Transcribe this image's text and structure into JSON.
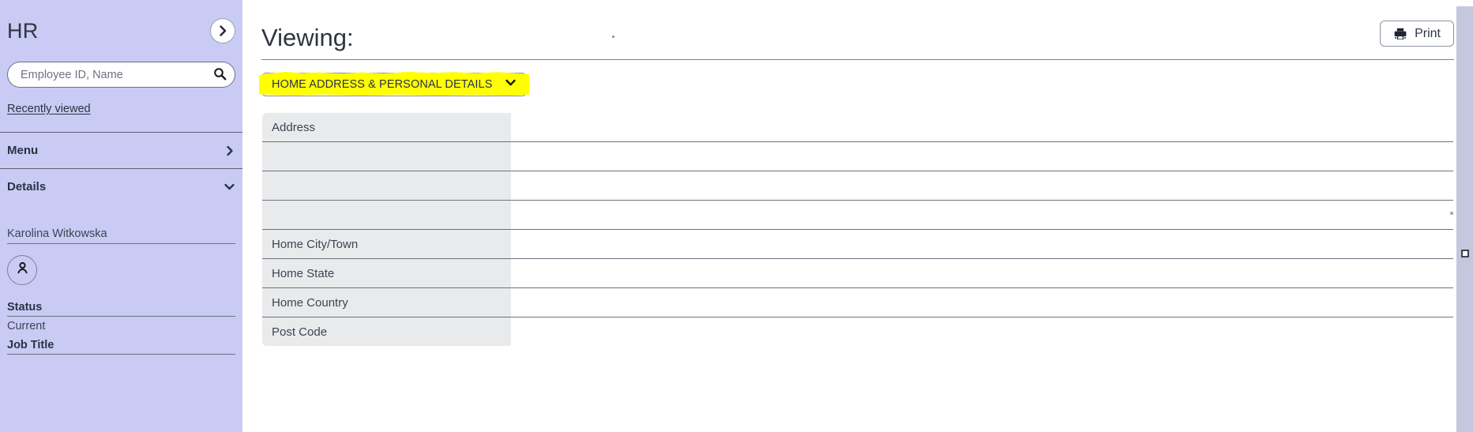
{
  "sidebar": {
    "title": "HR",
    "expand_icon": "chevron-right-circle-icon",
    "search": {
      "placeholder": "Employee ID, Name",
      "value": "",
      "icon": "search-icon"
    },
    "recently_viewed_label": "Recently viewed",
    "nav": [
      {
        "label": "Menu",
        "icon": "chevron-right-icon",
        "state": "collapsed"
      },
      {
        "label": "Details",
        "icon": "chevron-down-icon",
        "state": "expanded"
      }
    ],
    "employee_name": "Karolina Witkowska",
    "avatar_icon": "person-icon",
    "fields": [
      {
        "label": "Status",
        "value": "Current"
      },
      {
        "label": "Job Title",
        "value": ""
      }
    ]
  },
  "main": {
    "page_title": "Viewing:",
    "print_button": {
      "label": "Print",
      "icon": "printer-icon"
    },
    "section_dropdown": {
      "label": "HOME ADDRESS & PERSONAL DETAILS",
      "caret_icon": "chevron-down-icon",
      "highlight_color": "#ffff00"
    },
    "table": {
      "rows": [
        {
          "label": "Address",
          "value": ""
        },
        {
          "label": "",
          "value": ""
        },
        {
          "label": "",
          "value": ""
        },
        {
          "label": "",
          "value": ""
        },
        {
          "label": "Home City/Town",
          "value": ""
        },
        {
          "label": "Home State",
          "value": ""
        },
        {
          "label": "Home Country",
          "value": ""
        },
        {
          "label": "Post Code",
          "value": ""
        }
      ]
    }
  },
  "colors": {
    "sidebar_bg": "#c9cbf5",
    "table_label_bg": "#e9eaec",
    "border": "#6b7280",
    "text": "#3d4451",
    "highlight": "#ffff00",
    "scroll_track": "#c3c8de"
  }
}
